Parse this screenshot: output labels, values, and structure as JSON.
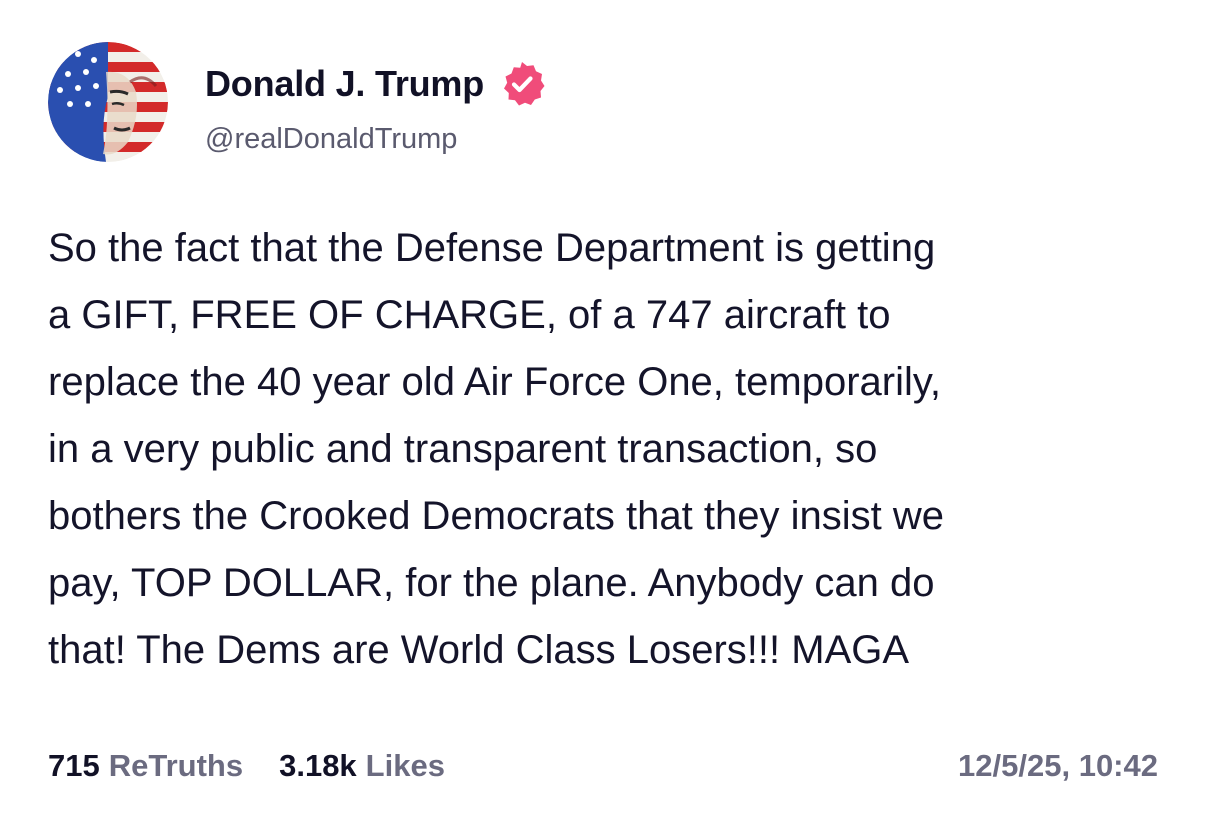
{
  "post": {
    "author": {
      "display_name": "Donald J. Trump",
      "handle": "@realDonaldTrump",
      "avatar_icon": "flag-portrait-avatar",
      "verified_icon": "verified-badge-icon",
      "verified_color": "#f04c7a"
    },
    "body": "So the fact that the Defense Department is getting\na GIFT, FREE OF CHARGE, of a 747 aircraft to\nreplace the 40 year old Air Force One, temporarily,\nin a very public and transparent transaction, so\nbothers the Crooked Democrats that they insist we\npay, TOP DOLLAR, for the plane. Anybody can do\nthat! The Dems are World Class Losers!!! MAGA",
    "stats": {
      "retruths_count": "715",
      "retruths_label": "ReTruths",
      "likes_count": "3.18k",
      "likes_label": "Likes"
    },
    "timestamp": "12/5/25, 10:42"
  }
}
